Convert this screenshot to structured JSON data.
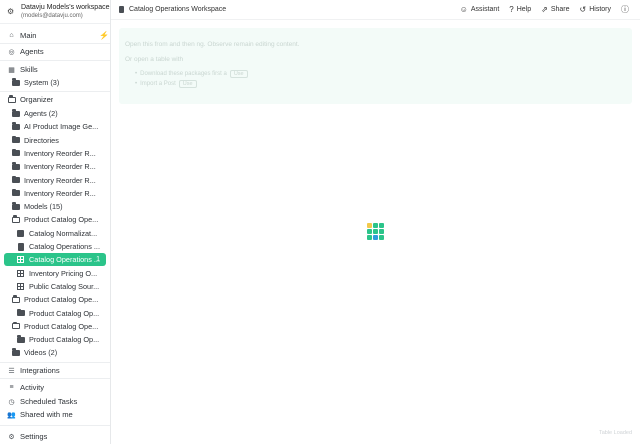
{
  "workspace": {
    "name": "Datavju Models's workspace",
    "email": "(models@datavju.com)"
  },
  "sidebar": {
    "main": "Main",
    "agents": "Agents",
    "skills": "Skills",
    "system": "System (3)",
    "organizer": "Organizer",
    "tree": [
      {
        "label": "Agents (2)",
        "icon": "folder"
      },
      {
        "label": "AI Product Image Ge...",
        "icon": "folder"
      },
      {
        "label": "Directories",
        "icon": "folder"
      },
      {
        "label": "Inventory Reorder R...",
        "icon": "folder"
      },
      {
        "label": "Inventory Reorder R...",
        "icon": "folder"
      },
      {
        "label": "Inventory Reorder R...",
        "icon": "folder"
      },
      {
        "label": "Inventory Reorder R...",
        "icon": "folder"
      },
      {
        "label": "Models (15)",
        "icon": "folder"
      },
      {
        "label": "Product Catalog Ope...",
        "icon": "folder-open"
      },
      {
        "label": "Catalog Normalizat...",
        "icon": "cube"
      },
      {
        "label": "Catalog Operations ...",
        "icon": "doc"
      },
      {
        "label": "Catalog Operations ...",
        "icon": "table",
        "badge": "1"
      },
      {
        "label": "Inventory Pricing O...",
        "icon": "table"
      },
      {
        "label": "Public Catalog Sour...",
        "icon": "table"
      },
      {
        "label": "Product Catalog Ope...",
        "icon": "folder-open"
      },
      {
        "label": "Product Catalog Op...",
        "icon": "folder"
      },
      {
        "label": "Product Catalog Ope...",
        "icon": "folder-open"
      },
      {
        "label": "Product Catalog Op...",
        "icon": "folder"
      },
      {
        "label": "Videos (2)",
        "icon": "folder"
      }
    ],
    "integrations": "Integrations",
    "activity": "Activity",
    "scheduled": "Scheduled Tasks",
    "shared": "Shared with me",
    "settings": "Settings"
  },
  "topbar": {
    "title": "Catalog Operations Workspace",
    "assistant": "Assistant",
    "help": "Help",
    "share": "Share",
    "history": "History"
  },
  "ghost": {
    "line1": "Open this from and then ng. Observe remain editing content.",
    "line2": "Or open a table with",
    "items": [
      {
        "text": "Download these packages first a",
        "btn": "Use"
      },
      {
        "text": "Import a Post",
        "btn": "Use"
      }
    ]
  },
  "loader_colors": [
    "#f2c94c",
    "#2bc48a",
    "#2bc48a",
    "#2bc48a",
    "#2bc48a",
    "#2bc48a",
    "#2bc48a",
    "#2d9cdb",
    "#2bc48a"
  ],
  "footer": "Table Loaded"
}
